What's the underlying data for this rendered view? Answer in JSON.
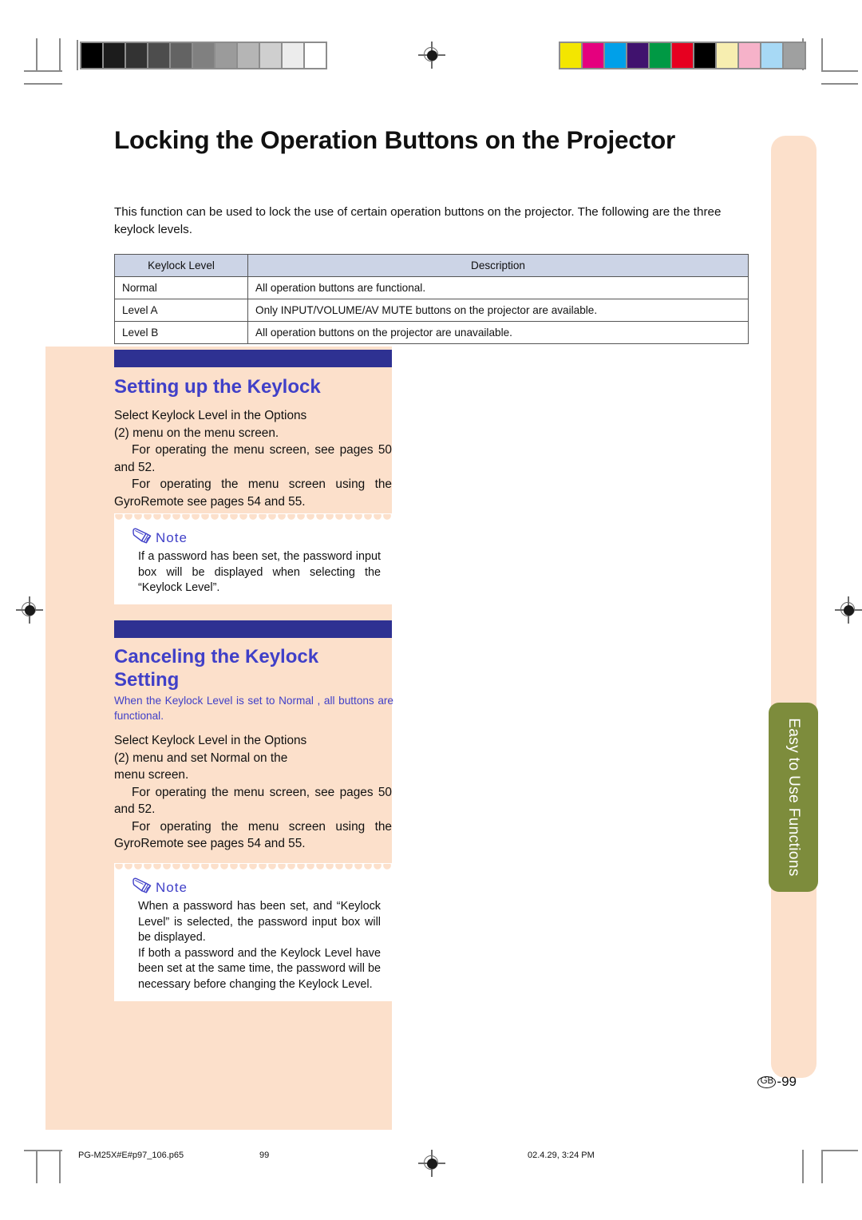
{
  "page": {
    "title": "Locking the Operation Buttons on the Projector",
    "intro": "This function can be used to lock the use of certain operation buttons on the projector. The following are the three keylock levels.",
    "page_number": "-99",
    "page_number_region": "GB",
    "side_tab_label": "Easy to Use Functions"
  },
  "table": {
    "headers": [
      "Keylock Level",
      "Description"
    ],
    "rows": [
      [
        "Normal",
        "All operation buttons are functional."
      ],
      [
        "Level A",
        "Only INPUT/VOLUME/AV MUTE buttons on the projector are available."
      ],
      [
        "Level B",
        "All operation buttons on the projector are unavailable."
      ]
    ]
  },
  "sections": [
    {
      "heading": "Setting up the Keylock",
      "body_line1": "Select  Keylock Level   in the  Options",
      "body_line2": "(2)  menu on the menu screen.",
      "body_line3": "For operating the menu screen, see pages 50 and 52.",
      "body_line4": "For operating the menu screen using the GyroRemote see pages 54 and 55.",
      "note": {
        "label": "Note",
        "paragraphs": [
          "If a password has been set, the password input box will be displayed when selecting the “Keylock Level”."
        ]
      }
    },
    {
      "heading_line1": "Canceling the Keylock",
      "heading_line2": "Setting",
      "subtitle": "When the Keylock Level is set to   Normal  , all buttons are functional.",
      "body_line1": "Select  Keylock Level   in the  Options",
      "body_line2": "(2)  menu and set      Normal   on the",
      "body_line3": "menu screen.",
      "body_line4": "For operating the menu screen, see pages 50 and 52.",
      "body_line5": "For operating the menu screen using the GyroRemote see pages 54 and 55.",
      "note": {
        "label": "Note",
        "paragraphs": [
          "When a password has been set, and “Keylock Level” is selected, the password input box will be displayed.",
          "If both a password and the Keylock Level have been set at the same time, the password will be necessary before changing the Keylock Level."
        ]
      }
    }
  ],
  "footer": {
    "filename": "PG-M25X#E#p97_106.p65",
    "page": "99",
    "timestamp": "02.4.29, 3:24 PM"
  },
  "printbars": {
    "grayscale": [
      "#000000",
      "#1c1c1c",
      "#333333",
      "#4d4d4d",
      "#636363",
      "#808080",
      "#9b9b9b",
      "#b5b5b5",
      "#cfcfcf",
      "#ececec",
      "#ffffff"
    ],
    "color": [
      "#f3e600",
      "#e5007e",
      "#00a0e9",
      "#40126e",
      "#009944",
      "#e60020",
      "#000000",
      "#f7eeb0",
      "#f6b2c9",
      "#a7d9f5",
      "#9fa0a0"
    ]
  },
  "colors": {
    "accent_blue": "#4040c8",
    "bar_blue": "#2e3192",
    "peach": "#fce0cb",
    "table_header": "#ccd4e6",
    "tab_green": "#7d8c3c"
  }
}
